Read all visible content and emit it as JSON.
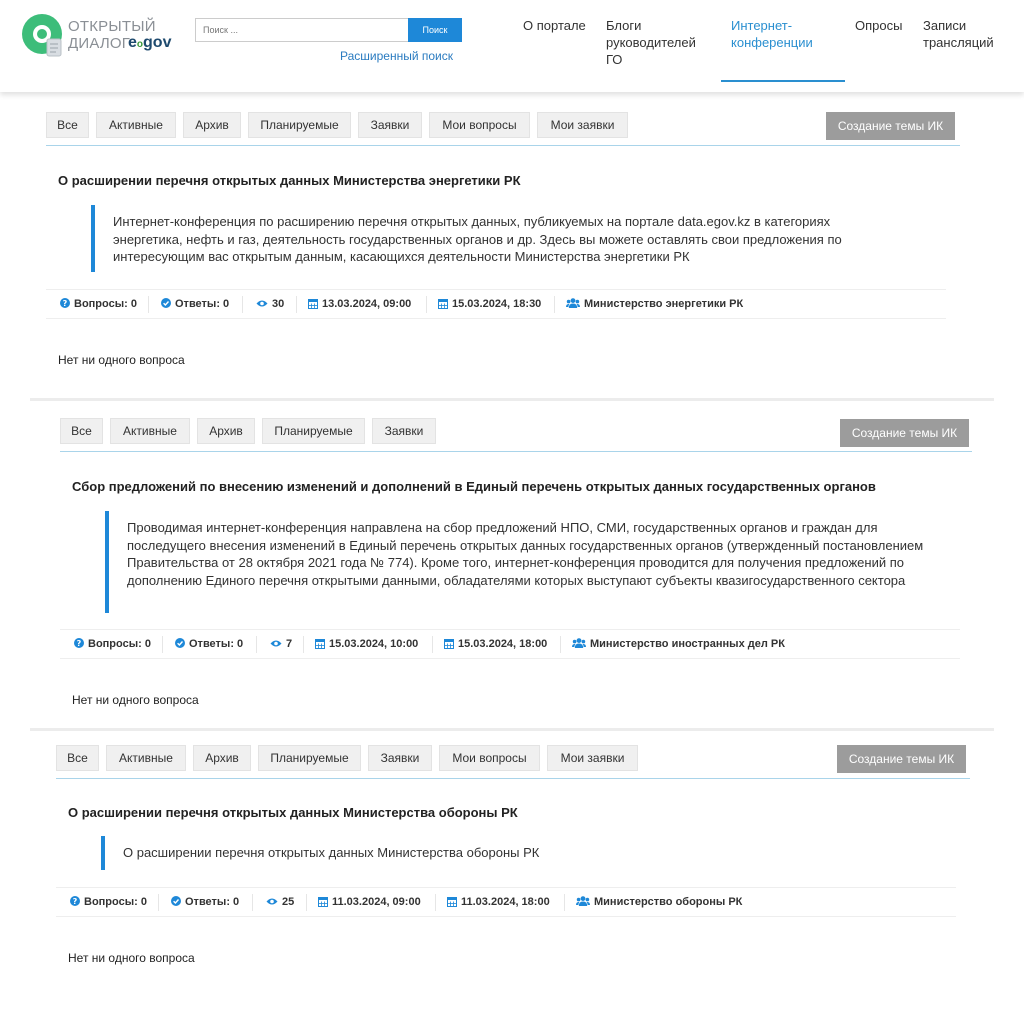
{
  "header": {
    "logo": {
      "line1": "ОТКРЫТЫЙ",
      "line2": "ДИАЛОГ",
      "egov": "egov",
      "egov_e": "e",
      "egov_sub": "o"
    },
    "search": {
      "placeholder": "Поиск ...",
      "button": "Поиск",
      "advanced": "Расширенный поиск"
    },
    "nav": [
      {
        "label": "О портале"
      },
      {
        "label": "Блоги руководителей ГО"
      },
      {
        "label": "Интернет-конференции",
        "active": true
      },
      {
        "label": "Опросы"
      },
      {
        "label": "Записи трансляций"
      }
    ]
  },
  "panels": [
    {
      "tabs": [
        "Все",
        "Активные",
        "Архив",
        "Планируемые",
        "Заявки",
        "Мои вопросы",
        "Мои заявки"
      ],
      "create_button": "Создание темы ИК",
      "title": "О расширении перечня открытых данных Министерства энергетики РК",
      "description": "Интернет-конференция по расширению перечня открытых данных, публикуемых на портале data.egov.kz в категориях энергетика, нефть и газ, деятельность государственных органов и др. Здесь вы можете оставлять свои предложения по интересующим вас открытым данным, касающихся деятельности Министерства энергетики РК",
      "meta": {
        "questions": "Вопросы: 0",
        "answers": "Ответы: 0",
        "views": "30",
        "start": "13.03.2024, 09:00",
        "end": "15.03.2024, 18:30",
        "org": "Министерство энергетики РК"
      },
      "empty": "Нет ни одного вопроса"
    },
    {
      "tabs": [
        "Все",
        "Активные",
        "Архив",
        "Планируемые",
        "Заявки"
      ],
      "create_button": "Создание темы ИК",
      "title": "Сбор предложений по внесению изменений и дополнений в Единый перечень открытых данных государственных органов",
      "description": "Проводимая интернет-конференция направлена на сбор предложений НПО, СМИ, государственных органов и граждан для последущего внесения изменений в Единый перечень открытых данных государственных органов (утвержденный постановлением Правительства от 28 октября 2021 года № 774). Кроме того, интернет-конференция проводится для получения предложений по дополнению Единого перечня открытыми данными, обладателями которых выступают субъекты квазигосударственного сектора",
      "meta": {
        "questions": "Вопросы: 0",
        "answers": "Ответы: 0",
        "views": "7",
        "start": "15.03.2024, 10:00",
        "end": "15.03.2024, 18:00",
        "org": "Министерство иностранных дел РК"
      },
      "empty": "Нет ни одного вопроса"
    },
    {
      "tabs": [
        "Все",
        "Активные",
        "Архив",
        "Планируемые",
        "Заявки",
        "Мои вопросы",
        "Мои заявки"
      ],
      "create_button": "Создание темы ИК",
      "title": "О расширении перечня открытых данных Министерства обороны РК",
      "description": "О расширении перечня открытых данных Министерства обороны РК",
      "meta": {
        "questions": "Вопросы: 0",
        "answers": "Ответы: 0",
        "views": "25",
        "start": "11.03.2024, 09:00",
        "end": "11.03.2024, 18:00",
        "org": "Министерство обороны РК"
      },
      "empty": "Нет ни одного вопроса"
    }
  ],
  "colors": {
    "accent": "#1e88d8",
    "nav_active": "#2a8fd0",
    "create_button": "#9c9c9c",
    "logo_green": "#3a9a3a"
  },
  "icons": [
    "question-circle-icon",
    "check-circle-icon",
    "eye-icon",
    "calendar-icon",
    "users-icon",
    "search-icon"
  ]
}
